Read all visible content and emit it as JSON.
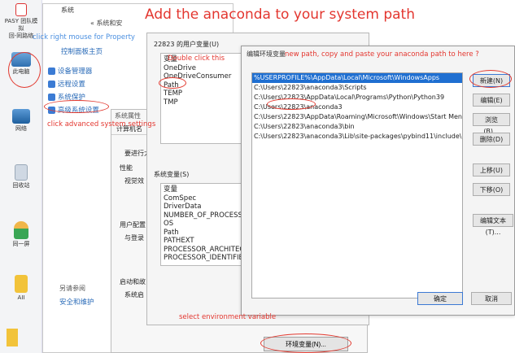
{
  "desktop": {
    "items": [
      {
        "label": "PASY 团队模拟",
        "sub": "回-同路络",
        "icon": "app-icon"
      },
      {
        "label": "此电脑",
        "icon": "computer-icon"
      },
      {
        "label": "网络",
        "icon": "network-icon"
      },
      {
        "label": "回收站",
        "icon": "recycle-bin-icon"
      },
      {
        "label": "同一屏",
        "icon": "user-icon"
      },
      {
        "label": "AII",
        "icon": "document-icon"
      }
    ]
  },
  "system_window": {
    "title": "系统",
    "breadcrumb": "« 系统和安",
    "home_link": "控制面板主页",
    "links": [
      "设备管理器",
      "远程设置",
      "系统保护",
      "高级系统设置"
    ],
    "see_also": "另请参阅",
    "see_also_link": "安全和维护"
  },
  "sysprops": {
    "title": "系统属性",
    "tab_computer": "计算机名",
    "section_admin": "要进行大",
    "section_perf": "性能",
    "perf_sub": "视觉效",
    "section_profile": "用户配置",
    "profile_sub": "与登录",
    "section_startup": "启动和故",
    "startup_sub": "系统启"
  },
  "env_dialog": {
    "user_vars_label": "22823 的用户变量(U)",
    "user_vars_header": "变量",
    "user_vars": [
      "OneDrive",
      "OneDriveConsumer",
      "Path",
      "TEMP",
      "TMP"
    ],
    "sys_vars_label": "系统变量(S)",
    "sys_vars_header": "变量",
    "sys_vars": [
      "ComSpec",
      "DriverData",
      "NUMBER_OF_PROCESSO",
      "OS",
      "Path",
      "PATHEXT",
      "PROCESSOR_ARCHITECT",
      "PROCESSOR_IDENTIFIER"
    ],
    "env_button": "环境变量(N)..."
  },
  "edit_dialog": {
    "title": "编辑环境变量",
    "paths": [
      "%USERPROFILE%\\AppData\\Local\\Microsoft\\WindowsApps",
      "C:\\Users\\22823\\anaconda3\\Scripts",
      "C:\\Users\\22823\\AppData\\Local\\Programs\\Python\\Python39",
      "C:\\Users\\22823\\anaconda3",
      "C:\\Users\\22823\\AppData\\Roaming\\Microsoft\\Windows\\Start Men...",
      "C:\\Users\\22823\\anaconda3\\bin",
      "C:\\Users\\22823\\anaconda3\\Lib\\site-packages\\pybind11\\include\\p..."
    ],
    "buttons": {
      "new": "新建(N)",
      "edit": "编辑(E)",
      "browse": "浏览(B)...",
      "delete": "删除(D)",
      "up": "上移(U)",
      "down": "下移(O)",
      "edit_text": "编辑文本(T)...",
      "ok": "确定",
      "cancel": "取消"
    }
  },
  "annotations": {
    "headline": "Add the anaconda to your system path",
    "right_click": "click right mouse for Property",
    "double_click": "Double click this",
    "new_path": "new path, copy and paste your anaconda path to here ?",
    "advanced": "click advanced system settings",
    "select_env": "select environment variable"
  },
  "colors": {
    "annotation_red": "#e3362f",
    "annotation_blue": "#4a8fe0",
    "selection": "#1f6fd1"
  }
}
